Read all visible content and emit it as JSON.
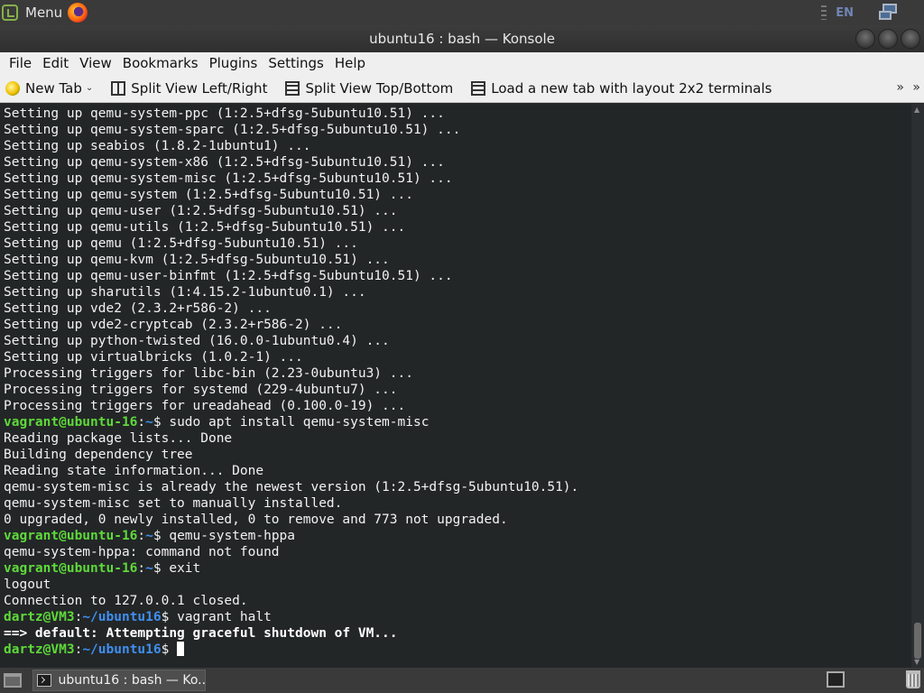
{
  "top_panel": {
    "menu_label": "Menu",
    "language": "EN",
    "menu_icon": "mint-logo-icon",
    "browser_icon": "firefox-icon",
    "network_icon": "network-icon"
  },
  "window": {
    "title": "ubuntu16 : bash — Konsole"
  },
  "menubar": {
    "items": [
      "File",
      "Edit",
      "View",
      "Bookmarks",
      "Plugins",
      "Settings",
      "Help"
    ]
  },
  "toolbar": {
    "new_tab": "New Tab",
    "split_lr": "Split View Left/Right",
    "split_tb": "Split View Top/Bottom",
    "load_layout": "Load a new tab with layout 2x2 terminals",
    "more": "»",
    "more2": "»"
  },
  "terminal": {
    "colors": {
      "background": "#232627",
      "user": "#5ed93a",
      "path": "#3f8ff0",
      "text": "#f2f2f2"
    },
    "lines": [
      {
        "text": "Setting up qemu-system-ppc (1:2.5+dfsg-5ubuntu10.51) ..."
      },
      {
        "text": "Setting up qemu-system-sparc (1:2.5+dfsg-5ubuntu10.51) ..."
      },
      {
        "text": "Setting up seabios (1.8.2-1ubuntu1) ..."
      },
      {
        "text": "Setting up qemu-system-x86 (1:2.5+dfsg-5ubuntu10.51) ..."
      },
      {
        "text": "Setting up qemu-system-misc (1:2.5+dfsg-5ubuntu10.51) ..."
      },
      {
        "text": "Setting up qemu-system (1:2.5+dfsg-5ubuntu10.51) ..."
      },
      {
        "text": "Setting up qemu-user (1:2.5+dfsg-5ubuntu10.51) ..."
      },
      {
        "text": "Setting up qemu-utils (1:2.5+dfsg-5ubuntu10.51) ..."
      },
      {
        "text": "Setting up qemu (1:2.5+dfsg-5ubuntu10.51) ..."
      },
      {
        "text": "Setting up qemu-kvm (1:2.5+dfsg-5ubuntu10.51) ..."
      },
      {
        "text": "Setting up qemu-user-binfmt (1:2.5+dfsg-5ubuntu10.51) ..."
      },
      {
        "text": "Setting up sharutils (1:4.15.2-1ubuntu0.1) ..."
      },
      {
        "text": "Setting up vde2 (2.3.2+r586-2) ..."
      },
      {
        "text": "Setting up vde2-cryptcab (2.3.2+r586-2) ..."
      },
      {
        "text": "Setting up python-twisted (16.0.0-1ubuntu0.4) ..."
      },
      {
        "text": "Setting up virtualbricks (1.0.2-1) ..."
      },
      {
        "text": "Processing triggers for libc-bin (2.23-0ubuntu3) ..."
      },
      {
        "text": "Processing triggers for systemd (229-4ubuntu7) ..."
      },
      {
        "text": "Processing triggers for ureadahead (0.100.0-19) ..."
      },
      {
        "user": "vagrant@ubuntu-16",
        "path": "~",
        "sym": "$ ",
        "text": "sudo apt install qemu-system-misc"
      },
      {
        "text": "Reading package lists... Done"
      },
      {
        "text": "Building dependency tree"
      },
      {
        "text": "Reading state information... Done"
      },
      {
        "text": "qemu-system-misc is already the newest version (1:2.5+dfsg-5ubuntu10.51)."
      },
      {
        "text": "qemu-system-misc set to manually installed."
      },
      {
        "text": "0 upgraded, 0 newly installed, 0 to remove and 773 not upgraded."
      },
      {
        "user": "vagrant@ubuntu-16",
        "path": "~",
        "sym": "$ ",
        "text": "qemu-system-hppa"
      },
      {
        "text": "qemu-system-hppa: command not found"
      },
      {
        "user": "vagrant@ubuntu-16",
        "path": "~",
        "sym": "$ ",
        "text": "exit"
      },
      {
        "text": "logout"
      },
      {
        "text": "Connection to 127.0.0.1 closed."
      },
      {
        "user": "dartz@VM3",
        "path": "~/ubuntu16",
        "sym": "$ ",
        "text": "vagrant halt"
      },
      {
        "bold": "==> default: Attempting graceful shutdown of VM..."
      },
      {
        "user": "dartz@VM3",
        "path": "~/ubuntu16",
        "sym": "$ ",
        "text": "",
        "cursor": true
      }
    ]
  },
  "taskbar": {
    "task_label": "ubuntu16 : bash — Ko..."
  }
}
